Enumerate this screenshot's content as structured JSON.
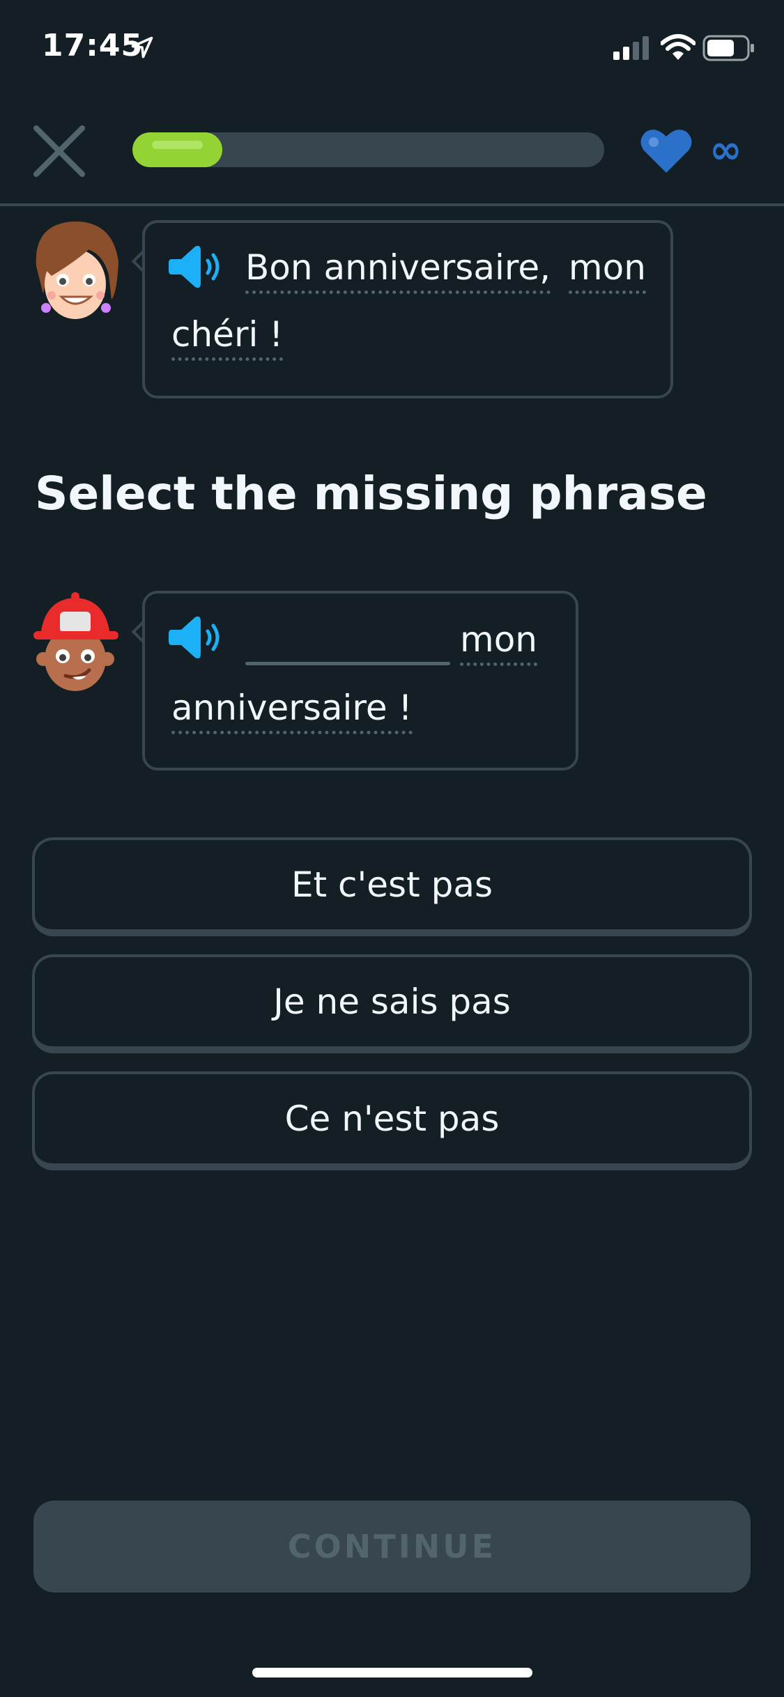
{
  "status_bar": {
    "time": "17:45",
    "icons": [
      "location-arrow-icon",
      "signal-icon",
      "wifi-icon",
      "battery-icon"
    ]
  },
  "top_bar": {
    "close_icon": "close-icon",
    "progress_fraction": 0.19,
    "hearts_icon": "heart-icon",
    "hearts_value": "∞"
  },
  "dialogue": {
    "line1": {
      "speaker_icon": "speaker-icon",
      "words": [
        "Bon anniversaire,",
        "mon",
        "chéri !"
      ]
    },
    "line2": {
      "speaker_icon": "speaker-icon",
      "words": [
        "mon",
        "anniversaire !"
      ]
    }
  },
  "prompt": "Select the missing phrase",
  "options": [
    "Et c'est pas",
    "Je ne sais pas",
    "Ce n'est pas"
  ],
  "continue_label": "CONTINUE",
  "colors": {
    "background": "#131f24",
    "border": "#37464f",
    "progress": "#93d333",
    "heart": "#2b70c9",
    "speaker": "#1cb0f6"
  }
}
